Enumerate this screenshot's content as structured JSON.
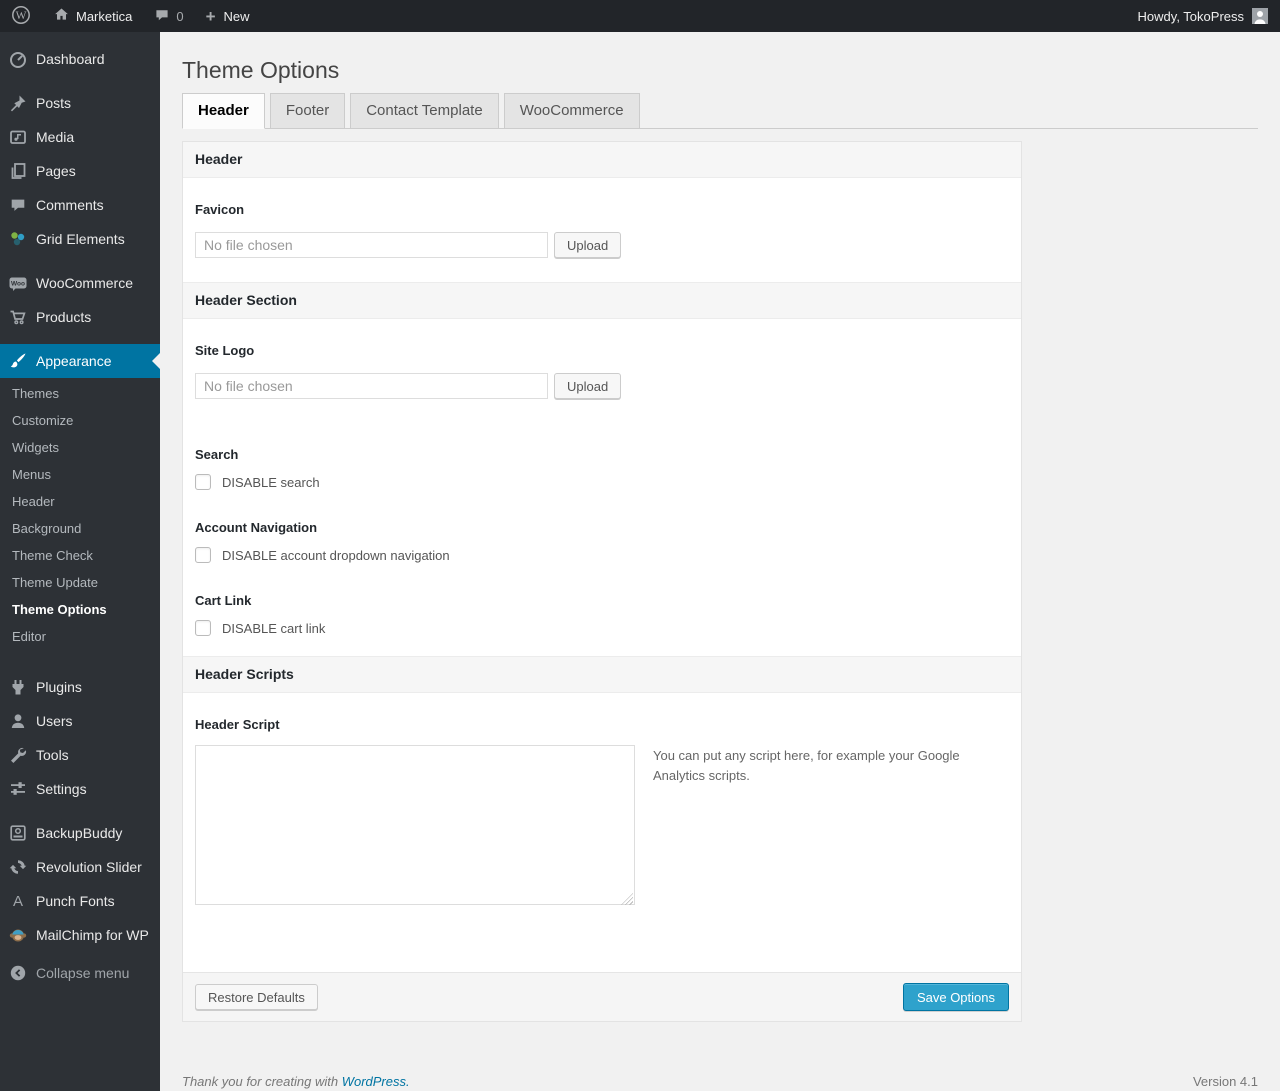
{
  "admin_bar": {
    "wp_glyph": "W",
    "site_name": "Marketica",
    "comment_count": "0",
    "plus_glyph": "+",
    "new_label": "New",
    "howdy": "Howdy, TokoPress"
  },
  "sidebar": {
    "items": [
      {
        "label": "Dashboard",
        "icon": "dashboard"
      },
      {
        "label": "Posts",
        "icon": "pushpin"
      },
      {
        "label": "Media",
        "icon": "media"
      },
      {
        "label": "Pages",
        "icon": "pages"
      },
      {
        "label": "Comments",
        "icon": "comment-bubble"
      },
      {
        "label": "Grid Elements",
        "icon": "grid-elements"
      },
      {
        "label": "WooCommerce",
        "icon": "woo-badge",
        "badge_text": "Woo"
      },
      {
        "label": "Products",
        "icon": "cart"
      },
      {
        "label": "Appearance",
        "icon": "paintbrush",
        "active": true
      },
      {
        "label": "Plugins",
        "icon": "plug"
      },
      {
        "label": "Users",
        "icon": "person"
      },
      {
        "label": "Tools",
        "icon": "wrench"
      },
      {
        "label": "Settings",
        "icon": "sliders"
      },
      {
        "label": "BackupBuddy",
        "icon": "backup-box"
      },
      {
        "label": "Revolution Slider",
        "icon": "refresh-arrows"
      },
      {
        "label": "Punch Fonts",
        "icon": "letter-a",
        "glyph": "A"
      },
      {
        "label": "MailChimp for WP",
        "icon": "monkey"
      },
      {
        "label": "Collapse menu",
        "icon": "collapse-arrow"
      }
    ],
    "appearance_submenu": [
      "Themes",
      "Customize",
      "Widgets",
      "Menus",
      "Header",
      "Background",
      "Theme Check",
      "Theme Update",
      "Theme Options",
      "Editor"
    ],
    "current_submenu_item": "Theme Options"
  },
  "page": {
    "title": "Theme Options"
  },
  "tabs": [
    {
      "label": "Header",
      "active": true
    },
    {
      "label": "Footer",
      "active": false
    },
    {
      "label": "Contact Template",
      "active": false
    },
    {
      "label": "WooCommerce",
      "active": false
    }
  ],
  "panel": {
    "sections": {
      "header": {
        "heading": "Header"
      },
      "header_section": {
        "heading": "Header Section"
      },
      "header_scripts": {
        "heading": "Header Scripts"
      }
    },
    "fields": {
      "favicon": {
        "label": "Favicon",
        "file_placeholder": "No file chosen",
        "button": "Upload"
      },
      "site_logo": {
        "label": "Site Logo",
        "file_placeholder": "No file chosen",
        "button": "Upload"
      },
      "search": {
        "label": "Search",
        "checkbox_label": "DISABLE search",
        "checked": false
      },
      "account_nav": {
        "label": "Account Navigation",
        "checkbox_label": "DISABLE account dropdown navigation",
        "checked": false
      },
      "cart_link": {
        "label": "Cart Link",
        "checkbox_label": "DISABLE cart link",
        "checked": false
      },
      "header_script": {
        "label": "Header Script",
        "value": "",
        "hint": "You can put any script here, for example your Google Analytics scripts."
      }
    },
    "footer_buttons": {
      "restore": "Restore Defaults",
      "save": "Save Options"
    }
  },
  "page_footer": {
    "thanks_text": "Thank you for creating with",
    "wordpress_link": "WordPress.",
    "version": "Version 4.1"
  },
  "colors": {
    "accent_blue": "#0074a2",
    "primary_button": "#2ea2cc",
    "adminbar_bg": "#222529",
    "sidebar_bg": "#2d3136",
    "page_bg": "#f1f1f1"
  }
}
